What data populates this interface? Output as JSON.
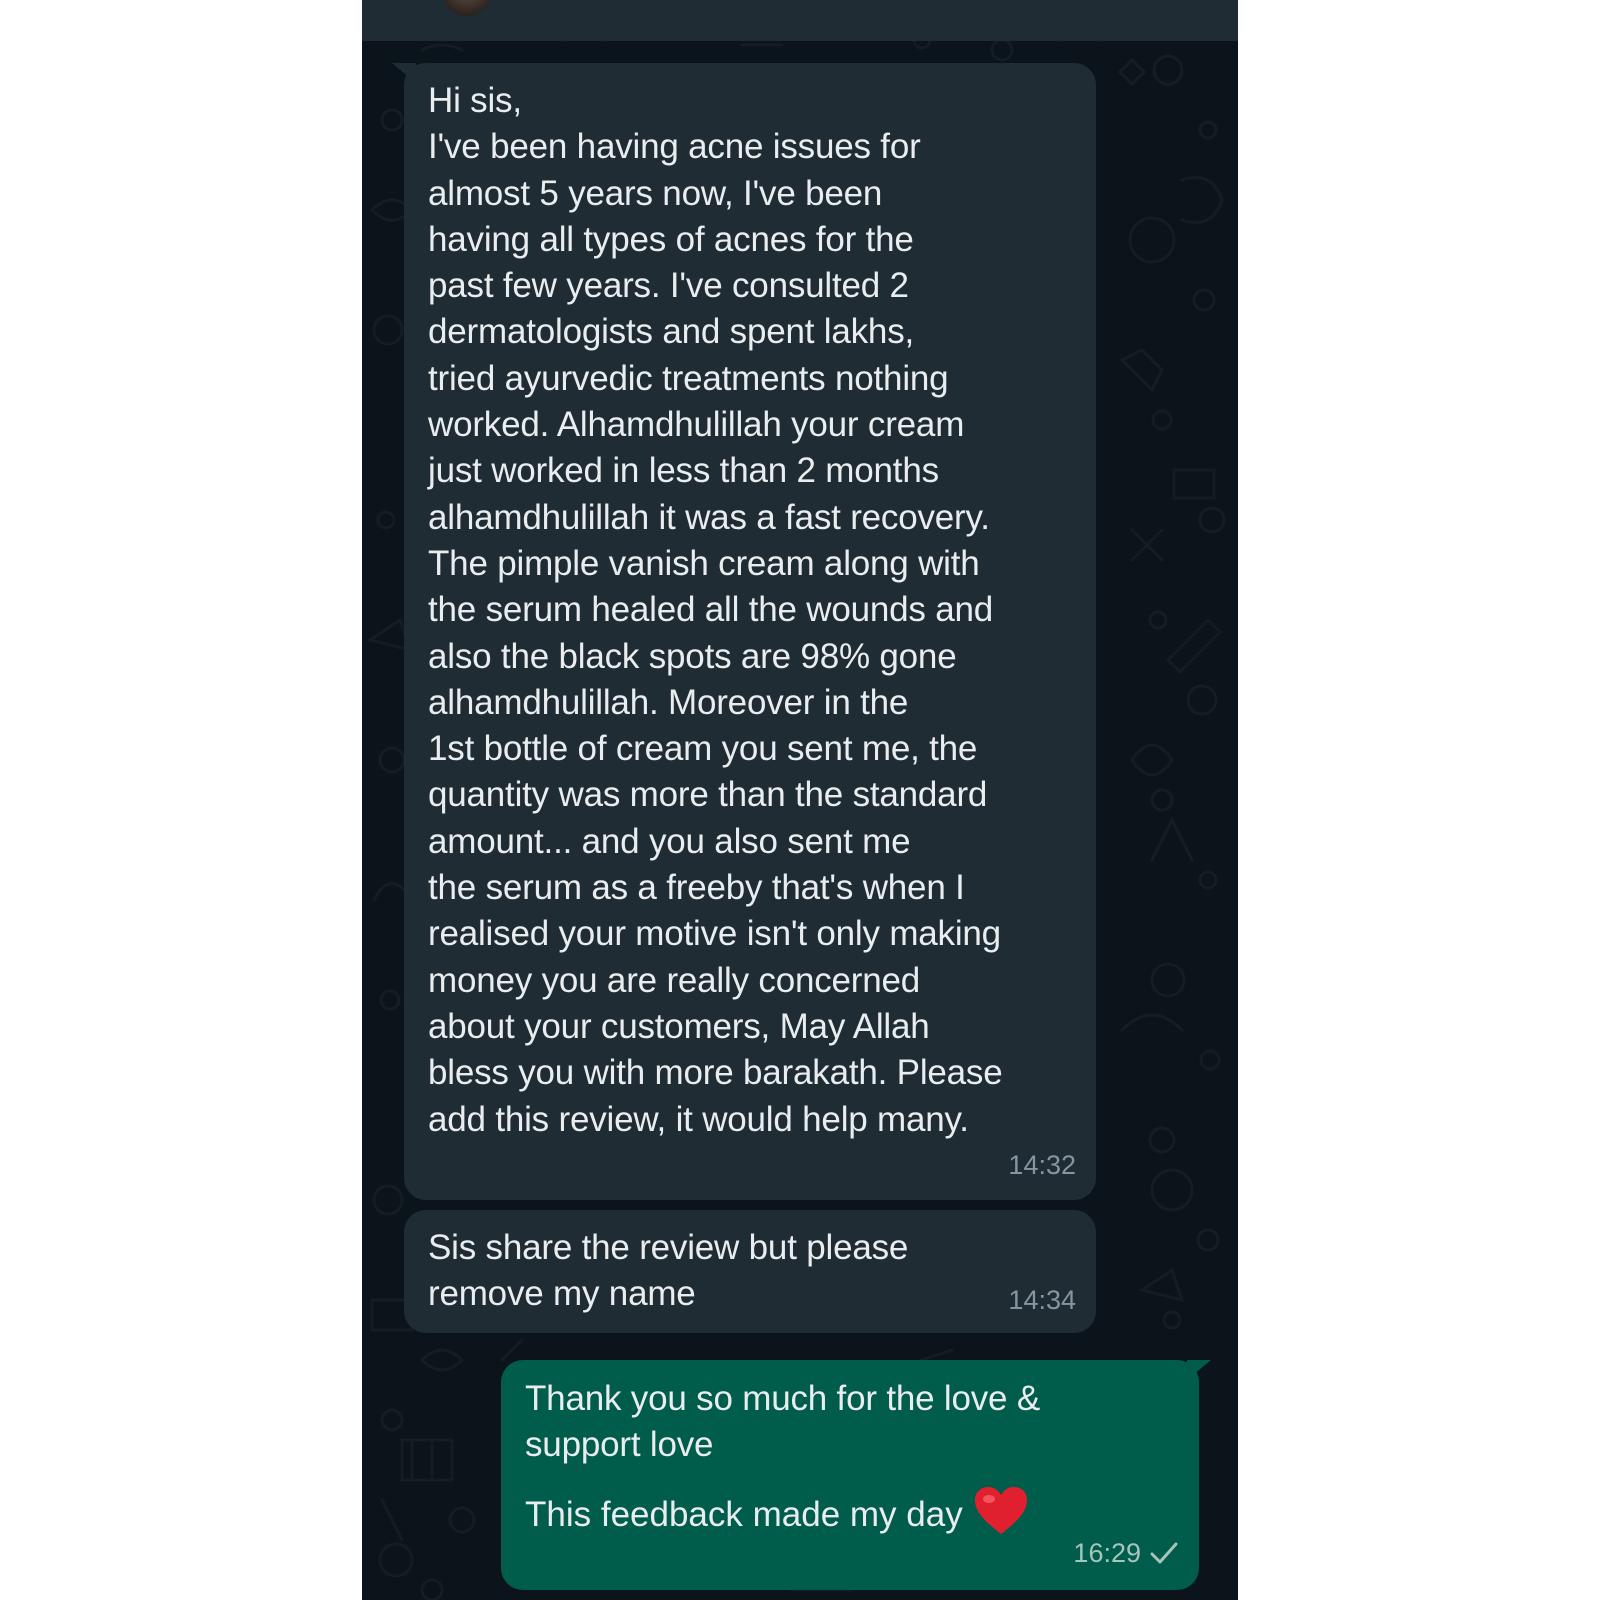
{
  "chat": {
    "messages": [
      {
        "direction": "incoming",
        "text": "Hi sis,\nI've been having acne issues for\nalmost 5 years now, I've been\nhaving all types of acnes for the\npast few years. I've consulted 2\ndermatologists and spent lakhs,\ntried ayurvedic treatments nothing\nworked. Alhamdhulillah your cream\njust worked in less than 2 months\nalhamdhulillah it was a fast recovery.\nThe pimple vanish cream along with\nthe serum healed all the wounds and\nalso the black spots are 98% gone\nalhamdhulillah. Moreover    in the\n1st bottle of cream you sent me, the\nquantity was more than the standard\namount... and you also sent me\nthe serum as a freeby that's when I\nrealised your motive isn't only making\nmoney you are really concerned\nabout your customers, May Allah\nbless you with more barakath. Please\nadd this review, it would help many.",
        "time": "14:32"
      },
      {
        "direction": "incoming",
        "text": "Sis share the review but please\nremove my name",
        "time": "14:34"
      },
      {
        "direction": "outgoing",
        "text_line1": "Thank you so much for the love &\nsupport love",
        "text_line2": "This feedback made my day",
        "emoji": "red-heart",
        "time": "16:29",
        "status": "sent-single-tick"
      }
    ]
  },
  "colors": {
    "background": "#0b141a",
    "incoming_bubble": "#202c33",
    "outgoing_bubble": "#005c4b",
    "text": "#e9edef",
    "timestamp": "#8696a0",
    "heart": "#e0202e"
  }
}
